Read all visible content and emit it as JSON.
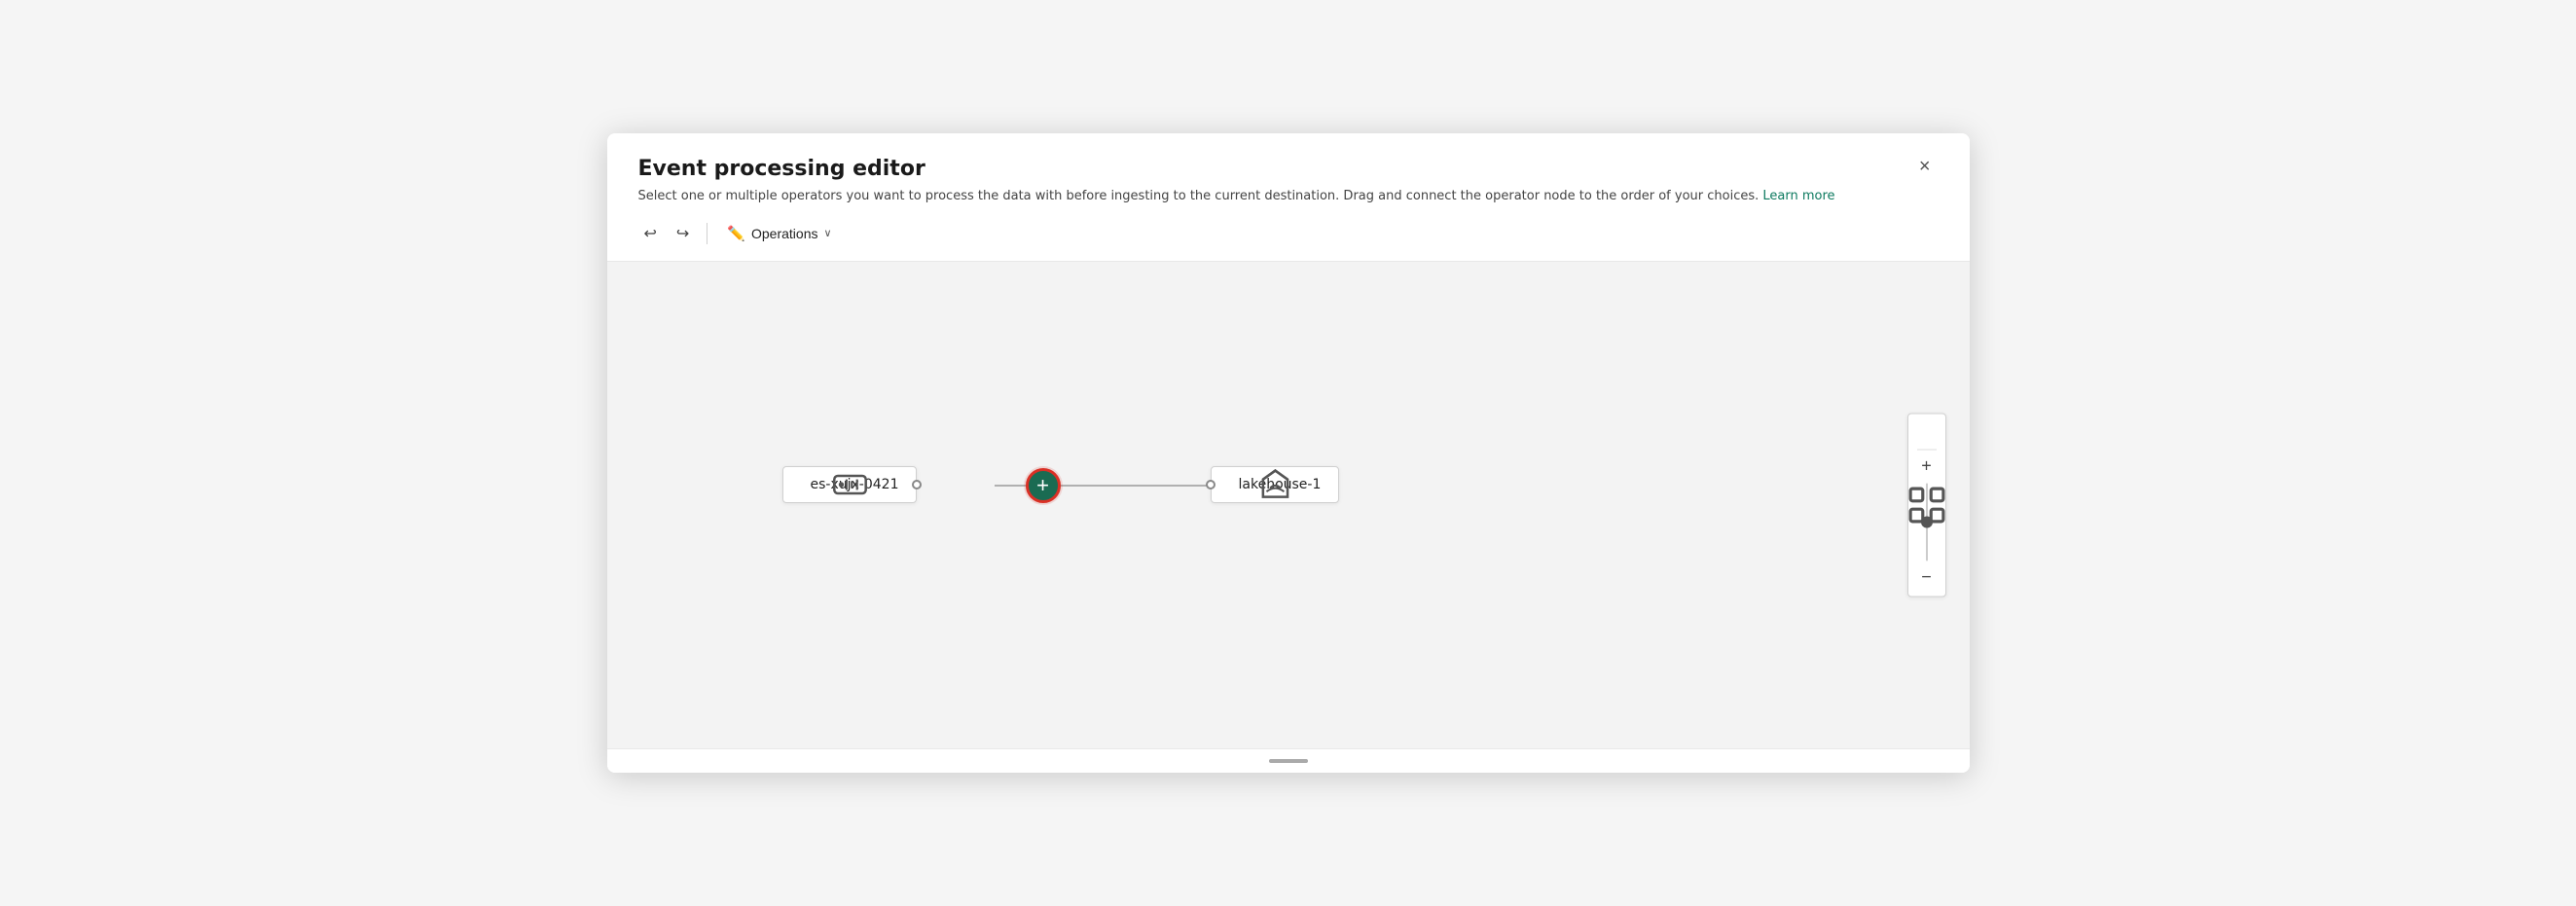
{
  "dialog": {
    "title": "Event processing editor",
    "subtitle": "Select one or multiple operators you want to process the data with before ingesting to the current destination. Drag and connect the operator node to the order of your choices.",
    "learn_more_label": "Learn more",
    "close_label": "×"
  },
  "toolbar": {
    "undo_label": "↩",
    "redo_label": "↪",
    "operations_label": "Operations",
    "operations_chevron": "∨"
  },
  "canvas": {
    "source_node_label": "es-xujx-0421",
    "dest_node_label": "lakehouse-1",
    "plus_label": "+"
  },
  "zoom": {
    "fit_icon": "⛶",
    "plus_icon": "+",
    "minus_icon": "−"
  }
}
